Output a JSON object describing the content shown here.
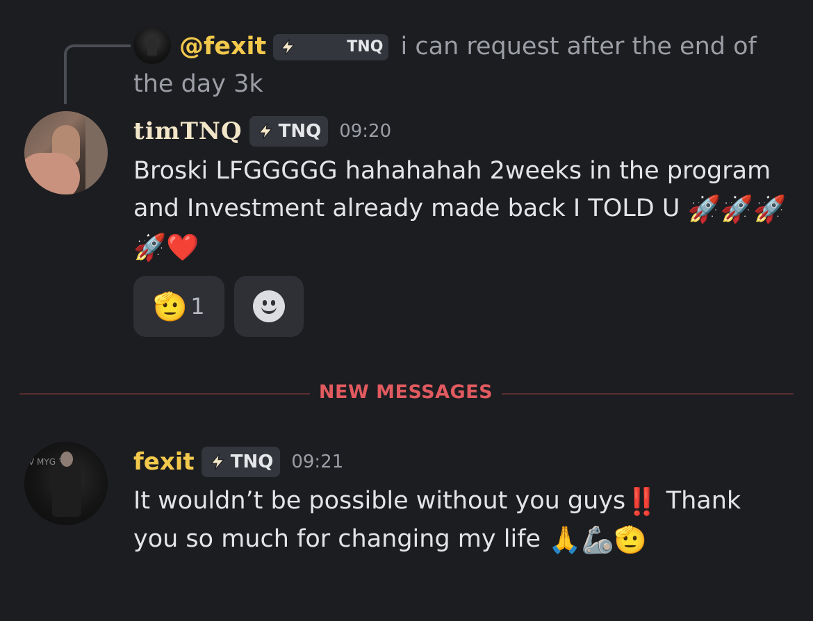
{
  "reply": {
    "username": "@fexit",
    "tag": "TNQ",
    "text": " i can request after the end of the day 3k"
  },
  "messages": [
    {
      "author": "timTNQ",
      "tag": "TNQ",
      "time": "09:20",
      "text": "Broski LFGGGGG hahahahah 2weeks in the program and Investment already made back I TOLD U ",
      "emojis": "🚀🚀🚀🚀",
      "heart": "❤️",
      "reactions": [
        {
          "emoji": "🫡",
          "count": "1"
        },
        {
          "emoji": "add-reaction-icon",
          "count": ""
        }
      ]
    },
    {
      "author": "fexit",
      "tag": "TNQ",
      "time": "09:21",
      "text_a": "It wouldn’t be possible without you guys",
      "bang": "‼️",
      "text_b": " Thank you so much for changing my life ",
      "emojis": "🙏🦾🫡"
    }
  ],
  "divider": {
    "label": "NEW MESSAGES"
  },
  "colors": {
    "background": "#1c1d21",
    "username_gold": "#f2c94c",
    "new_messages_red": "#e05a5f"
  }
}
